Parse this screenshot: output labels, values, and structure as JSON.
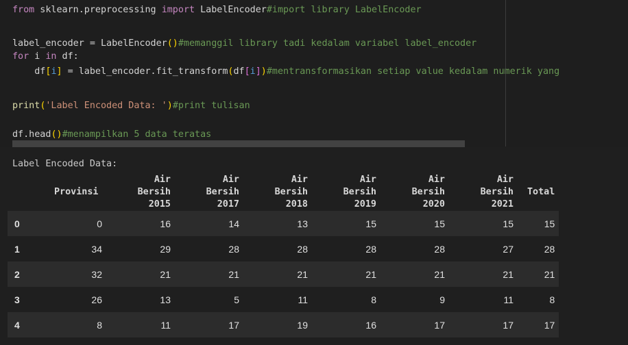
{
  "code": {
    "l1_kw1": "from",
    "l1_mod": " sklearn.preprocessing ",
    "l1_kw2": "import",
    "l1_name": " LabelEncoder",
    "l1_comment": "#import library LabelEncoder",
    "l3_text": "label_encoder = LabelEncoder",
    "l3_parens": "()",
    "l3_comment": "#memanggil library tadi kedalam variabel label_encoder",
    "l4_kw1": "for",
    "l4_mid": " i ",
    "l4_kw2": "in",
    "l4_end": " df:",
    "l5_a": "    df",
    "l5_b1": "[",
    "l5_i": "i",
    "l5_b2": "]",
    "l5_c": " = label_encoder.fit_transform",
    "l5_p1": "(",
    "l5_d": "df",
    "l5_b3": "[",
    "l5_i2": "i",
    "l5_b4": "]",
    "l5_p2": ")",
    "l5_comment": "#mentransformasikan setiap value kedalam numerik yang",
    "l7_fn": "print",
    "l7_p1": "(",
    "l7_str": "'Label Encoded Data: '",
    "l7_p2": ")",
    "l7_comment": "#print tulisan",
    "l9_text": "df.head",
    "l9_parens": "()",
    "l9_comment": "#menampilkan 5 data teratas"
  },
  "output": {
    "label": "Label Encoded Data:",
    "headers": [
      [
        "",
        ""
      ],
      [
        "",
        "Provinsi"
      ],
      [
        "Air Bersih",
        "2015"
      ],
      [
        "Air Bersih",
        "2017"
      ],
      [
        "Air Bersih",
        "2018"
      ],
      [
        "Air Bersih",
        "2019"
      ],
      [
        "Air Bersih",
        "2020"
      ],
      [
        "Air Bersih",
        "2021"
      ],
      [
        "",
        "Total"
      ]
    ],
    "rows": [
      [
        "0",
        "0",
        "16",
        "14",
        "13",
        "15",
        "15",
        "15",
        "15"
      ],
      [
        "1",
        "34",
        "29",
        "28",
        "28",
        "28",
        "28",
        "27",
        "28"
      ],
      [
        "2",
        "32",
        "21",
        "21",
        "21",
        "21",
        "21",
        "21",
        "21"
      ],
      [
        "3",
        "26",
        "13",
        "5",
        "11",
        "8",
        "9",
        "11",
        "8"
      ],
      [
        "4",
        "8",
        "11",
        "17",
        "19",
        "16",
        "17",
        "17",
        "17"
      ]
    ]
  },
  "colors": {
    "keyword": "#c586c0",
    "comment": "#6a9955",
    "string": "#ce9178",
    "background": "#1e1e1e"
  }
}
